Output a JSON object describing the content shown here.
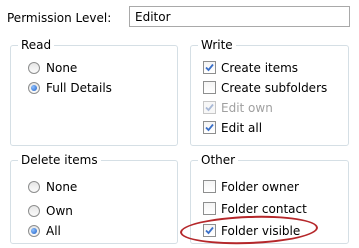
{
  "permission": {
    "label": "Permission Level:",
    "value": "Editor"
  },
  "read": {
    "title": "Read",
    "options": [
      {
        "label": "None",
        "checked": false
      },
      {
        "label": "Full Details",
        "checked": true
      }
    ]
  },
  "write": {
    "title": "Write",
    "options": [
      {
        "label": "Create items",
        "checked": true,
        "enabled": true
      },
      {
        "label": "Create subfolders",
        "checked": false,
        "enabled": true
      },
      {
        "label": "Edit own",
        "checked": true,
        "enabled": false
      },
      {
        "label": "Edit all",
        "checked": true,
        "enabled": true
      }
    ]
  },
  "delete_items": {
    "title": "Delete items",
    "options": [
      {
        "label": "None",
        "checked": false
      },
      {
        "label": "Own",
        "checked": false
      },
      {
        "label": "All",
        "checked": true
      }
    ]
  },
  "other": {
    "title": "Other",
    "options": [
      {
        "label": "Folder owner",
        "checked": false,
        "enabled": true
      },
      {
        "label": "Folder contact",
        "checked": false,
        "enabled": true
      },
      {
        "label": "Folder visible",
        "checked": true,
        "enabled": true
      }
    ]
  },
  "annotation": {
    "color": "#b5272a",
    "target": "Folder visible"
  }
}
